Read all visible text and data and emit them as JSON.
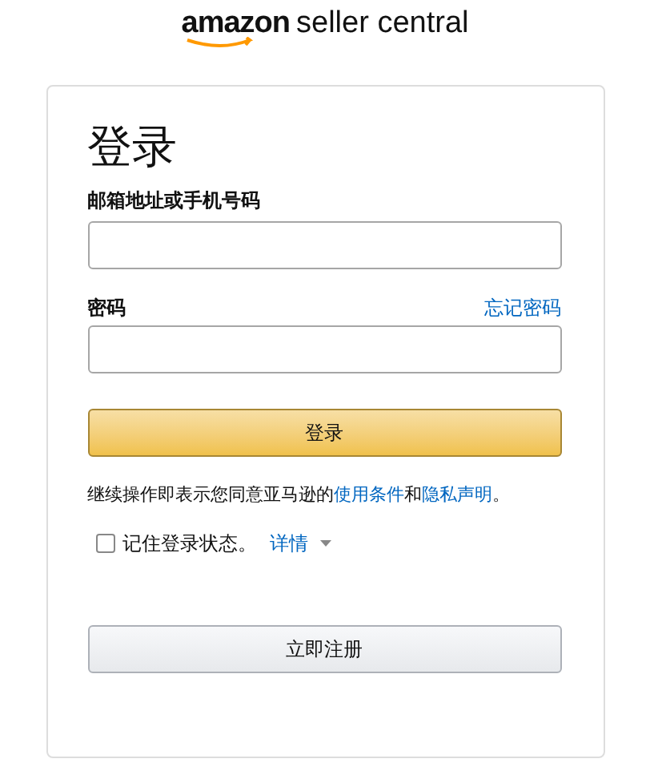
{
  "logo": {
    "brand": "amazon",
    "product": "seller central"
  },
  "title": "登录",
  "email": {
    "label": "邮箱地址或手机号码"
  },
  "password": {
    "label": "密码",
    "forgot_link": "忘记密码"
  },
  "sign_in_button": "登录",
  "terms": {
    "before": "继续操作即表示您同意亚马逊的",
    "link_1": "使用条件",
    "middle": "和",
    "link_2": "隐私声明",
    "after": "。"
  },
  "remember": {
    "label": "记住登录状态。",
    "checked": false,
    "details_link": "详情"
  },
  "register_button": "立即注册"
}
